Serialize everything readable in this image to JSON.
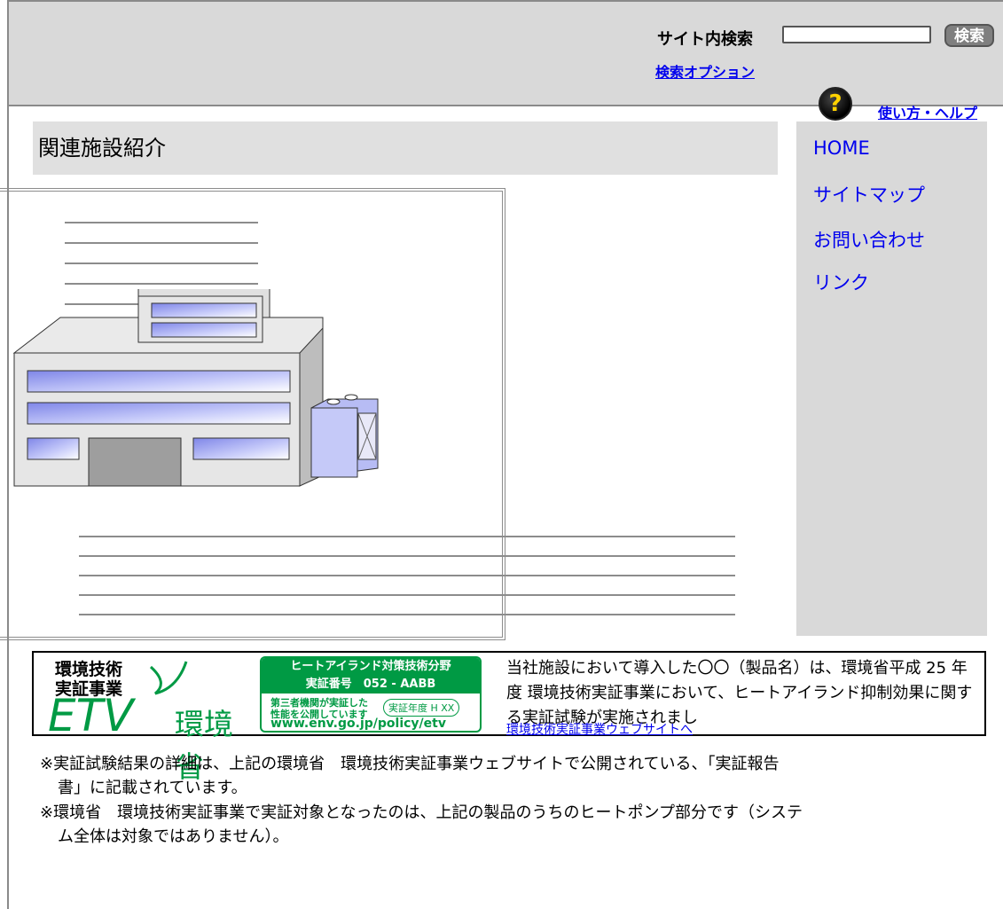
{
  "header": {
    "search_label": "サイト内検索",
    "search_value": "",
    "search_button": "検索",
    "search_option": "検索オプション",
    "help_icon": "question-circle-icon",
    "help_glyph": "?",
    "help_link": "使い方・ヘルプ"
  },
  "main": {
    "page_title": "関連施設紹介",
    "image": "building-illustration"
  },
  "sidebar": {
    "items": [
      {
        "label": "HOME"
      },
      {
        "label": "サイトマップ"
      },
      {
        "label": "お問い合わせ"
      },
      {
        "label": "リンク"
      }
    ]
  },
  "etv": {
    "logo_line1": "環境技術",
    "logo_line2": "実証事業",
    "logo_mark": "ETV",
    "logo_ministry": "環境省",
    "cert_line1": "ヒートアイランド対策技術分野",
    "cert_line2": "実証番号　052 - AABB",
    "cert_line3": "第三者機関が実証した",
    "cert_line4": "性能を公開しています",
    "cert_badge": "実証年度 H XX",
    "cert_url": "www.env.go.jp/policy/etv",
    "description": "当社施設において導入した〇〇（製品名）は、環境省平成 25 年度 環境技術実証事業において、ヒートアイランド抑制効果に関する実証試験が実施されまし",
    "link": "環境技術実証事業ウェブサイトへ"
  },
  "notes": [
    {
      "line1": "※実証試験結果の詳細は、上記の環境省　環境技術実証事業ウェブサイトで公開されている、「実証報告",
      "line2": "書」に記載されています。"
    },
    {
      "line1": "※環境省　環境技術実証事業で実証対象となったのは、上記の製品のうちのヒートポンプ部分です（システ",
      "line2": "ム全体は対象ではありません）。"
    }
  ],
  "colors": {
    "accent_green": "#009a44",
    "link_blue": "#0000ee",
    "header_gray": "#d9d9d9"
  }
}
